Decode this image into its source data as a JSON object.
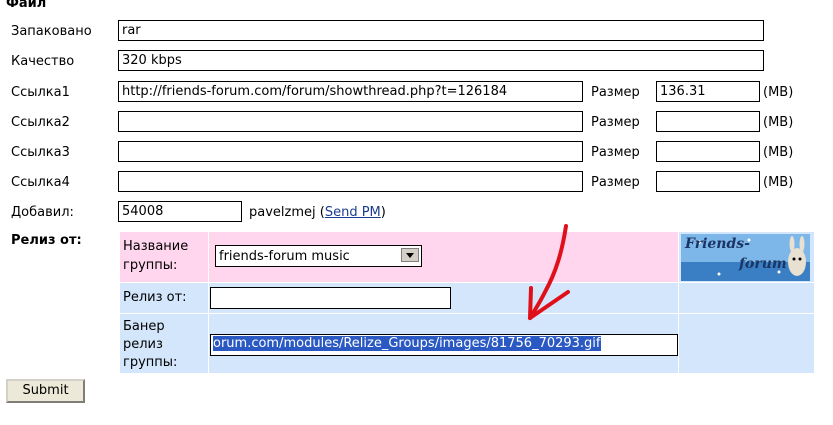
{
  "section_title": "Файл",
  "fields": {
    "packed": {
      "label": "Запаковано",
      "value": "rar"
    },
    "quality": {
      "label": "Качество",
      "value": "320 kbps"
    },
    "link1": {
      "label": "Ссылка1",
      "value": "http://friends-forum.com/forum/showthread.php?t=126184",
      "size_label": "Размер",
      "size_value": "136.31",
      "unit": "(MB)"
    },
    "link2": {
      "label": "Ссылка2",
      "value": "",
      "size_label": "Размер",
      "size_value": "",
      "unit": "(MB)"
    },
    "link3": {
      "label": "Ссылка3",
      "value": "",
      "size_label": "Размер",
      "size_value": "",
      "unit": "(MB)"
    },
    "link4": {
      "label": "Ссылка4",
      "value": "",
      "size_label": "Размер",
      "size_value": "",
      "unit": "(MB)"
    },
    "added_by": {
      "label": "Добавил:",
      "value": "54008",
      "username": "pavelzmej",
      "send_pm_open": "(",
      "send_pm": "Send PM",
      "send_pm_close": ")"
    }
  },
  "release": {
    "label": "Релиз от:",
    "group_name_label_1": "Название",
    "group_name_label_2": "группы:",
    "group_select_value": "friends-forum music",
    "release_from_label": "Релиз от:",
    "release_from_value": "",
    "banner_label_1": "Банер",
    "banner_label_2": "релиз",
    "banner_label_3": "группы:",
    "banner_value": "orum.com/modules/Relize_Groups/images/81756_70293.gif",
    "logo_text_1": "Friends-",
    "logo_text_2": "forum"
  },
  "submit_label": "Submit",
  "colors": {
    "pink": "#ffd6ee",
    "blue": "#d3e6fb",
    "arrow": "#e0101a",
    "link": "#1a3d8f"
  }
}
